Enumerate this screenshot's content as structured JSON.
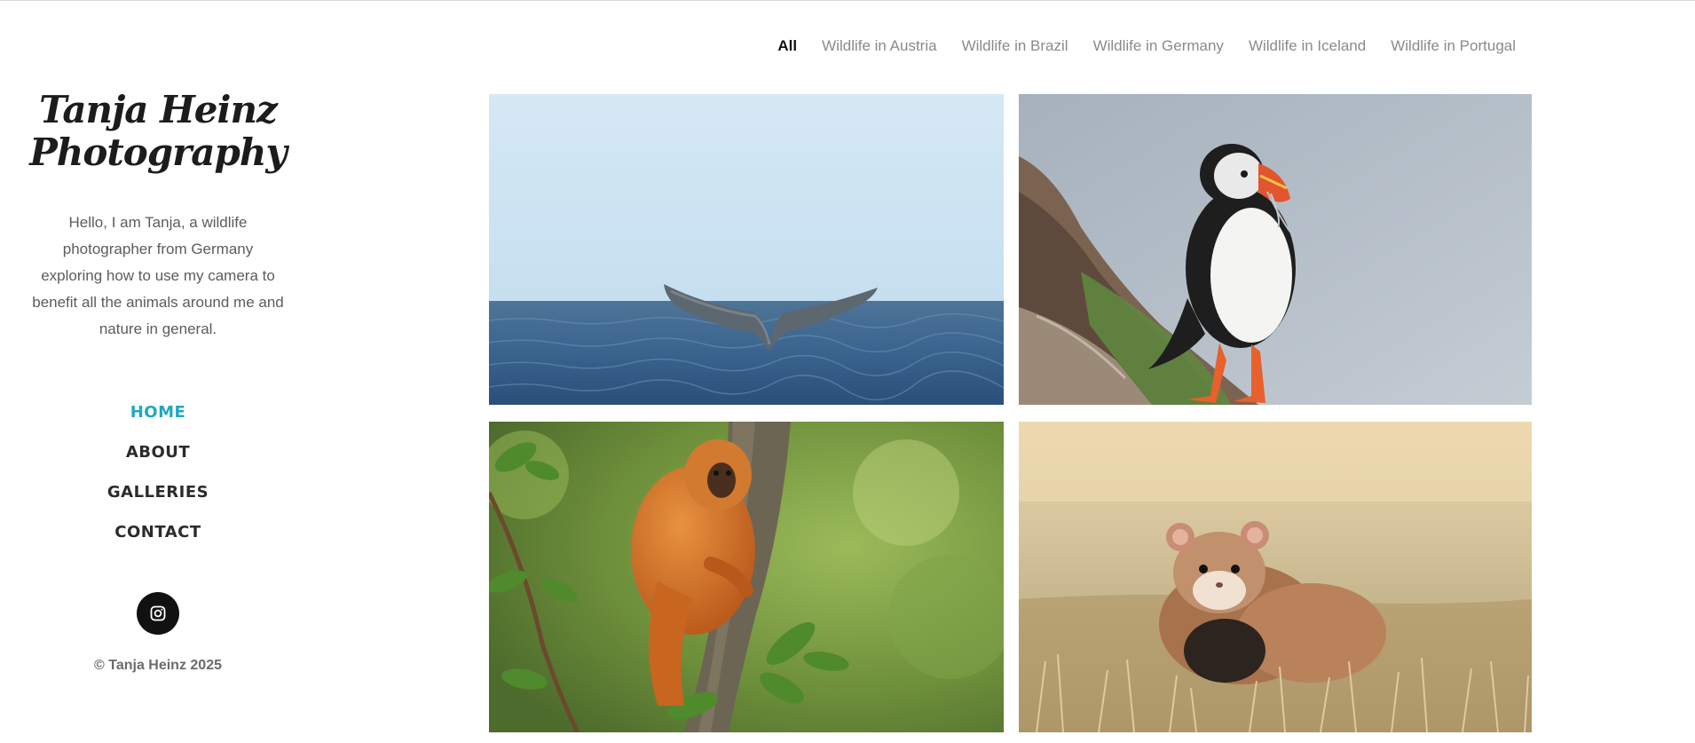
{
  "site": {
    "logo_line1": "Tanja Heinz",
    "logo_line2": "Photography",
    "intro": "Hello, I am Tanja, a wildlife photographer from Germany exploring how to use my camera to benefit all the animals around me and nature in general.",
    "copyright": "© Tanja Heinz 2025"
  },
  "nav": {
    "items": [
      "HOME",
      "ABOUT",
      "GALLERIES",
      "CONTACT"
    ],
    "active": "HOME"
  },
  "social": {
    "icon": "instagram-icon"
  },
  "filters": {
    "items": [
      "All",
      "Wildlife in Austria",
      "Wildlife in Brazil",
      "Wildlife in Germany",
      "Wildlife in Iceland",
      "Wildlife in Portugal"
    ],
    "active": "All"
  },
  "gallery": [
    {
      "subject": "whale-tail-photo"
    },
    {
      "subject": "puffin-photo"
    },
    {
      "subject": "golden-lion-tamarin-photo"
    },
    {
      "subject": "hamster-photo"
    }
  ],
  "colors": {
    "accent": "#1ea8c4",
    "text": "#2b2b2b",
    "muted": "#8a8a8a"
  }
}
